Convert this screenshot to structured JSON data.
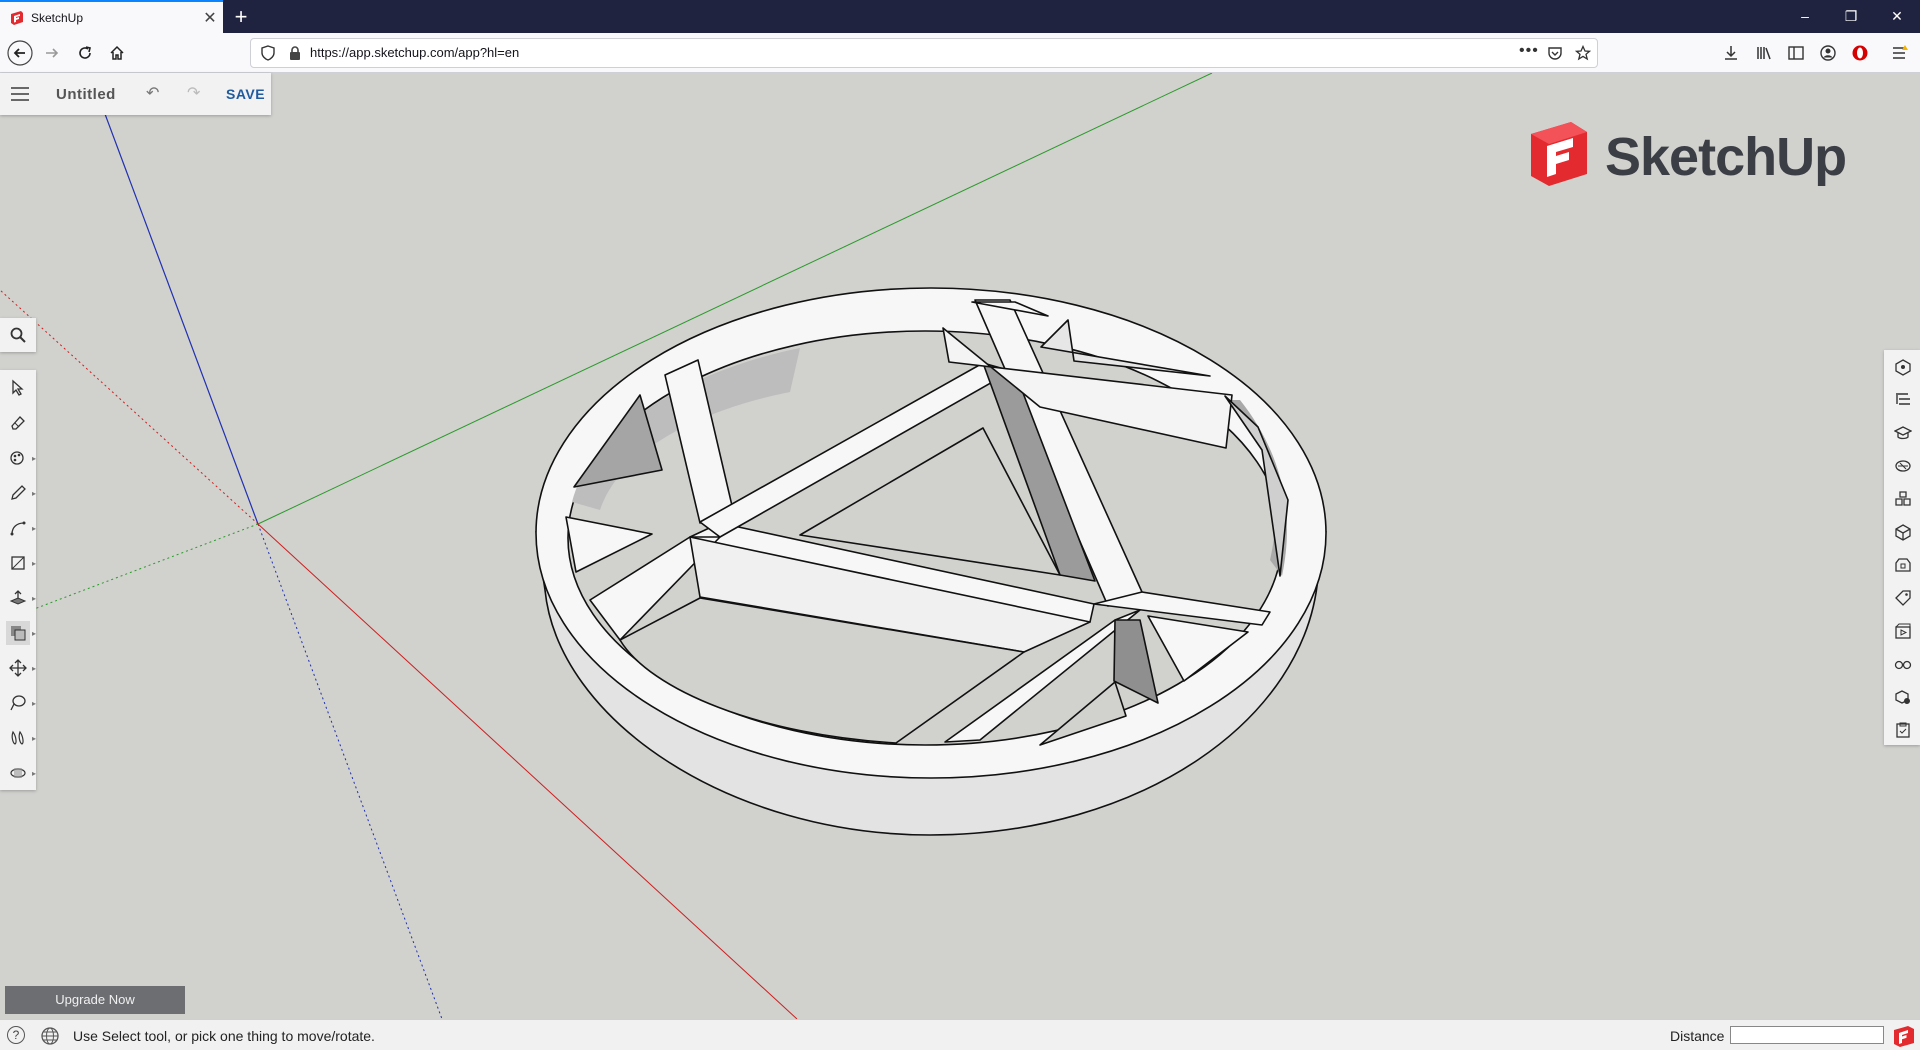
{
  "browser": {
    "tab_title": "SketchUp",
    "new_tab": "+",
    "url": "https://app.sketchup.com/app?hl=en",
    "window_controls": [
      "–",
      "❐",
      "✕"
    ]
  },
  "app": {
    "doc_title": "Untitled",
    "save_label": "SAVE",
    "logo_text": "SketchUp",
    "upgrade_label": "Upgrade Now"
  },
  "left_toolbar": {
    "search": "search-icon",
    "tools": [
      "select-icon",
      "eraser-icon",
      "paint-bucket-icon",
      "pencil-icon",
      "arc-icon",
      "rectangle-icon",
      "push-pull-icon",
      "offset-icon",
      "move-icon",
      "tape-measure-icon",
      "walk-icon",
      "orbit-icon"
    ]
  },
  "right_toolbar": {
    "panels": [
      "entity-info-icon",
      "outliner-icon",
      "instructor-icon",
      "materials-icon",
      "components-icon",
      "styles-icon",
      "scenes-3d-icon",
      "tags-icon",
      "scenes-icon",
      "display-icon",
      "solid-inspector-icon",
      "report-icon"
    ]
  },
  "status": {
    "message": "Use Select tool, or pick one thing to move/rotate.",
    "help": "?",
    "distance_label": "Distance",
    "distance_value": ""
  },
  "colors": {
    "viewport_bg": "#d1d1ce",
    "axis_red": "#cc2020",
    "axis_green": "#2a9a2a",
    "axis_blue": "#2030b0",
    "brand_red": "#e32a2f",
    "save_blue": "#1f5b9e"
  }
}
